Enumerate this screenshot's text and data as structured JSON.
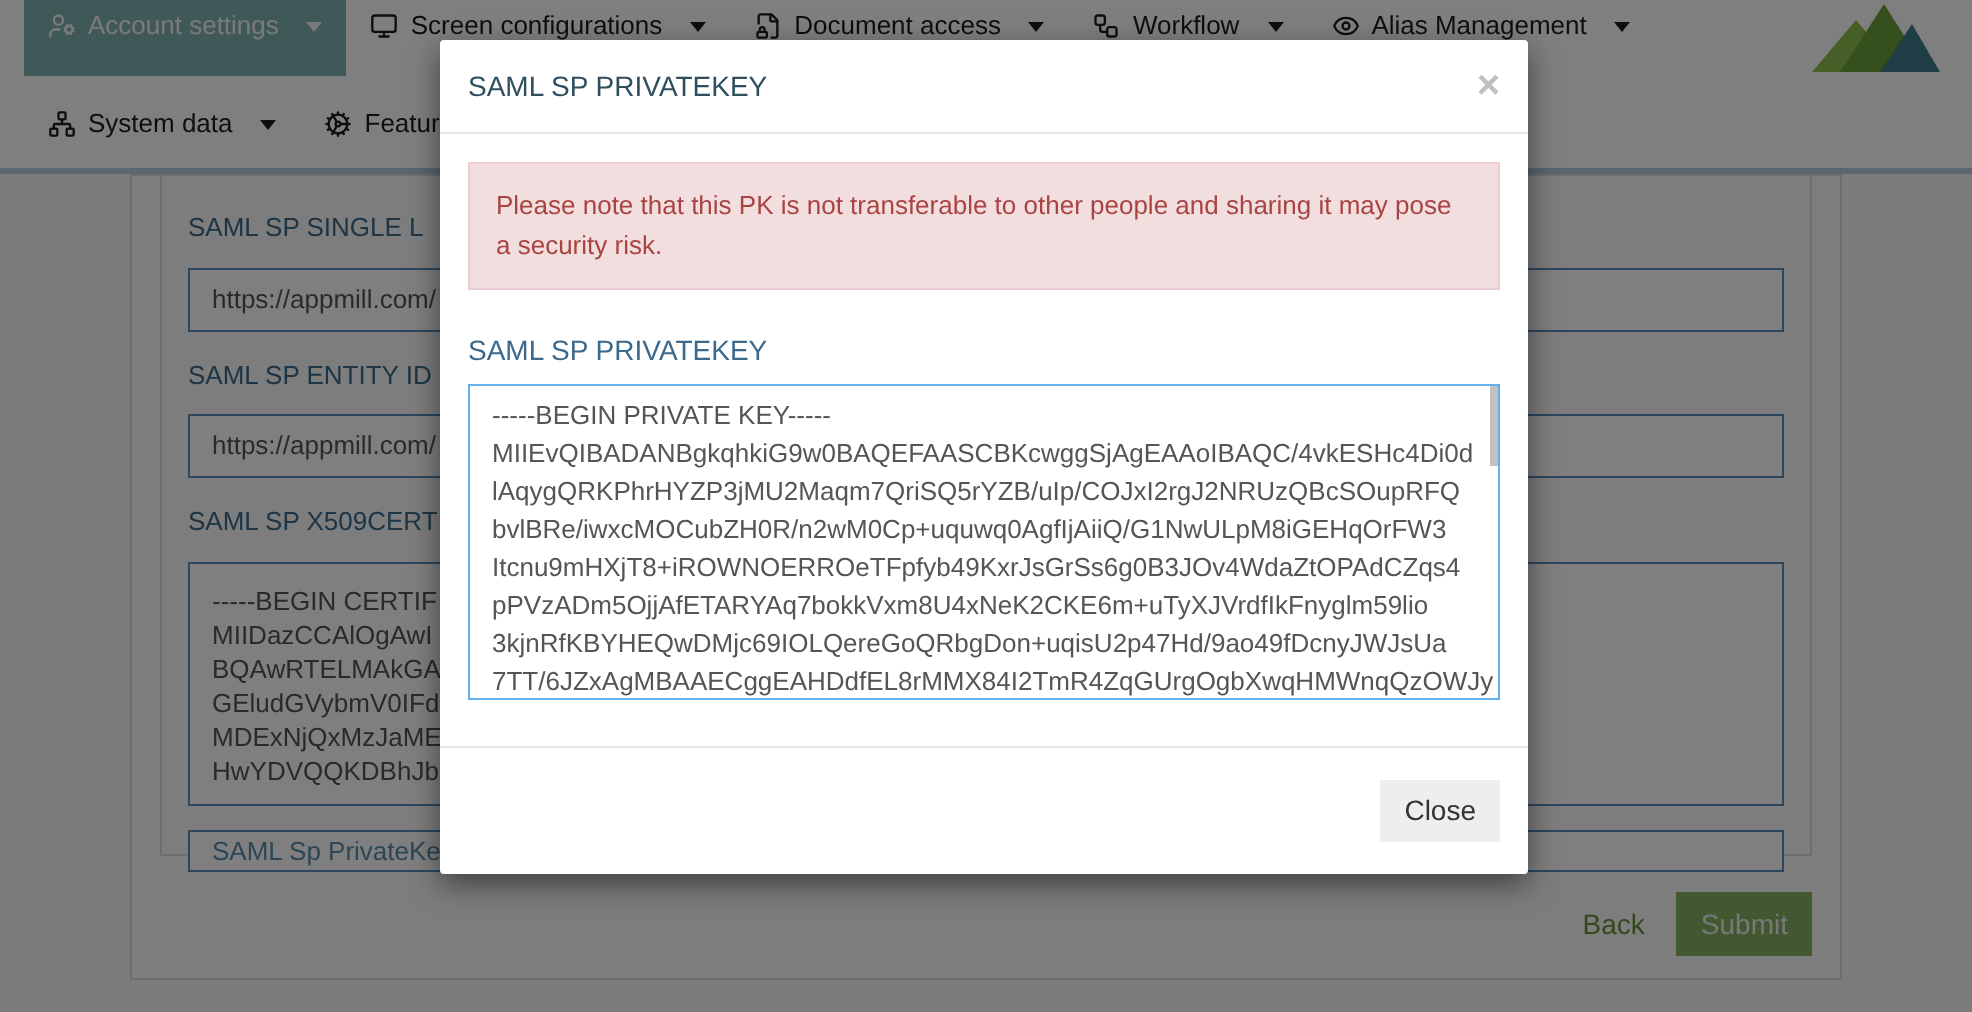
{
  "nav_rows": [
    [
      {
        "label": "Account settings",
        "selected": true,
        "caret": true
      },
      {
        "label": "Screen configurations",
        "selected": false,
        "caret": true
      },
      {
        "label": "Document access",
        "selected": false,
        "caret": true
      },
      {
        "label": "Workflow",
        "selected": false,
        "caret": true
      },
      {
        "label": "Alias Management",
        "selected": false,
        "caret": true
      }
    ],
    [
      {
        "label": "System data",
        "selected": false,
        "caret": true
      },
      {
        "label": "Featur",
        "selected": false,
        "caret": false
      }
    ]
  ],
  "form": {
    "fields": [
      {
        "kind": "input",
        "label": "SAML SP SINGLE L",
        "value": "https://appmill.com/"
      },
      {
        "kind": "input",
        "label": "SAML SP ENTITY ID",
        "value": "https://appmill.com/"
      },
      {
        "kind": "textarea",
        "label": "SAML SP X509CERT",
        "lines": [
          "-----BEGIN CERTIF",
          "MIIDazCCAlOgAwI",
          "BQAwRTELMAkGA",
          "GEludGVybmV0IFd",
          "MDExNjQxMzJaME",
          "HwYDVQQKDBhJb"
        ]
      },
      {
        "kind": "button",
        "label": "SAML Sp PrivateKe"
      }
    ],
    "back": "Back",
    "submit": "Submit"
  },
  "modal": {
    "title": "SAML SP PRIVATEKEY",
    "close_icon": "×",
    "alert": "Please note that this PK is not transferable to other people and sharing it may pose a security risk.",
    "label": "SAML SP PRIVATEKEY",
    "key_lines": [
      "-----BEGIN PRIVATE KEY-----",
      "MIIEvQIBADANBgkqhkiG9w0BAQEFAASCBKcwggSjAgEAAoIBAQC/4vkESHc4Di0d",
      "lAqygQRKPhrHYZP3jMU2Maqm7QriSQ5rYZB/uIp/COJxI2rgJ2NRUzQBcSOupRFQ",
      "bvlBRe/iwxcMOCubZH0R/n2wM0Cp+uquwq0AgfIjAiiQ/G1NwULpM8iGEHqOrFW3",
      "Itcnu9mHXjT8+iROWNOERROeTFpfyb49KxrJsGrSs6g0B3JOv4WdaZtOPAdCZqs4",
      "pPVzADm5OjjAfETARYAq7bokkVxm8U4xNeK2CKE6m+uTyXJVrdfIkFnyglm59lio",
      "3kjnRfKBYHEQwDMjc69IOLQereGoQRbgDon+uqisU2p47Hd/9ao49fDcnyJWJsUa",
      "7TT/6JZxAgMBAAECggEAHDdfEL8rMMX84I2TmR4ZqGUrgOgbXwqHMWnqQzOWJy"
    ],
    "close": "Close"
  }
}
